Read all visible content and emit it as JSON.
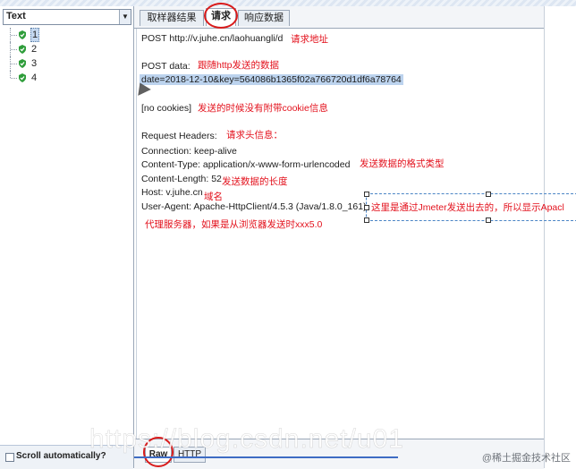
{
  "left_panel": {
    "renderer_label": "Text",
    "tree_items": [
      {
        "label": "1",
        "selected": true
      },
      {
        "label": "2",
        "selected": false
      },
      {
        "label": "3",
        "selected": false
      },
      {
        "label": "4",
        "selected": false
      }
    ],
    "scroll_label": "Scroll automatically?"
  },
  "tabs": [
    {
      "label": "取样器结果",
      "active": false
    },
    {
      "label": "请求",
      "active": true
    },
    {
      "label": "响应数据",
      "active": false
    }
  ],
  "request_lines": {
    "post_line": "POST http://v.juhe.cn/laohuangli/d",
    "post_data_label": "POST data:",
    "post_data_value": "date=2018-12-10&key=564086b1365f02a766720d1df6a78764",
    "cookies": "[no cookies]",
    "headers_label": "Request Headers:",
    "connection": "Connection: keep-alive",
    "content_type": "Content-Type: application/x-www-form-urlencoded",
    "content_length": "Content-Length: 52",
    "host": "Host: v.juhe.cn",
    "user_agent": "User-Agent: Apache-HttpClient/4.5.3 (Java/1.8.0_161)"
  },
  "annotations": {
    "request_url": "请求地址",
    "post_data": "跟随http发送的数据",
    "no_cookie": "发送的时候没有附带cookie信息",
    "headers": "请求头信息：",
    "content_type": "发送数据的格式类型",
    "content_length": "发送数据的长度",
    "host": "域名",
    "user_agent": "这里是通过Jmeter发送出去的，所以显示Apacl",
    "proxy": "代理服务器，如果是从浏览器发送时xxx5.0"
  },
  "bottom_tabs": [
    "Raw",
    "HTTP"
  ],
  "watermark": "https://blog.csdn.net/u01",
  "credit": "@稀土掘金技术社区",
  "colors": {
    "annotation": "#e3121d",
    "highlight": "#bcd3ee",
    "icon": "#2e9d3a"
  }
}
